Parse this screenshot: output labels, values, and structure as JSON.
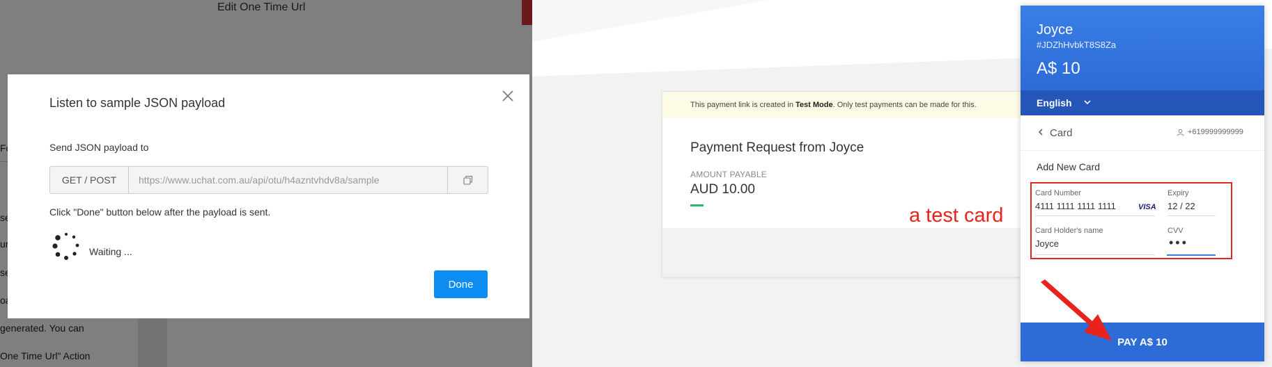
{
  "background_editor": {
    "title": "Edit One Time Url",
    "fragments": [
      "Fo",
      "se",
      "ur",
      "se",
      "oa",
      "generated. You can",
      "One Time Url\" Action"
    ]
  },
  "modal": {
    "title": "Listen to sample JSON payload",
    "send_label": "Send JSON payload to",
    "method": "GET / POST",
    "url": "https://www.uchat.com.au/api/otu/h4azntvhdv8a/sample",
    "instruction": "Click \"Done\" button below after the payload is sent.",
    "waiting": "Waiting ...",
    "done_label": "Done",
    "close_icon": "close-icon",
    "copy_icon": "copy-icon",
    "spinner_icon": "spinner-icon"
  },
  "payment_page": {
    "notice_prefix": "This payment link is created in ",
    "notice_bold": "Test Mode",
    "notice_suffix": ". Only test payments can be made for this.",
    "request_title": "Payment Request from Joyce",
    "amount_label": "AMOUNT PAYABLE",
    "amount": "AUD 10.00"
  },
  "checkout": {
    "name": "Joyce",
    "order_id": "#JDZhHvbkT8S8Za",
    "price": "A$ 10",
    "language": "English",
    "method": "Card",
    "phone": "+619999999999",
    "add_new_card": "Add New Card",
    "card_number_label": "Card Number",
    "card_number": "4111 1111 1111 1111",
    "card_brand": "VISA",
    "expiry_label": "Expiry",
    "expiry": "12 / 22",
    "holder_label": "Card Holder's name",
    "holder": "Joyce",
    "cvv_label": "CVV",
    "cvv_masked": "•••",
    "pay_label": "PAY A$ 10"
  },
  "annotation": {
    "text": "a test card",
    "color": "#e8221c"
  },
  "colors": {
    "brand_blue": "#2d6bd6",
    "done_blue": "#0d8cf2",
    "test_mode_bg": "#fdfae6"
  }
}
